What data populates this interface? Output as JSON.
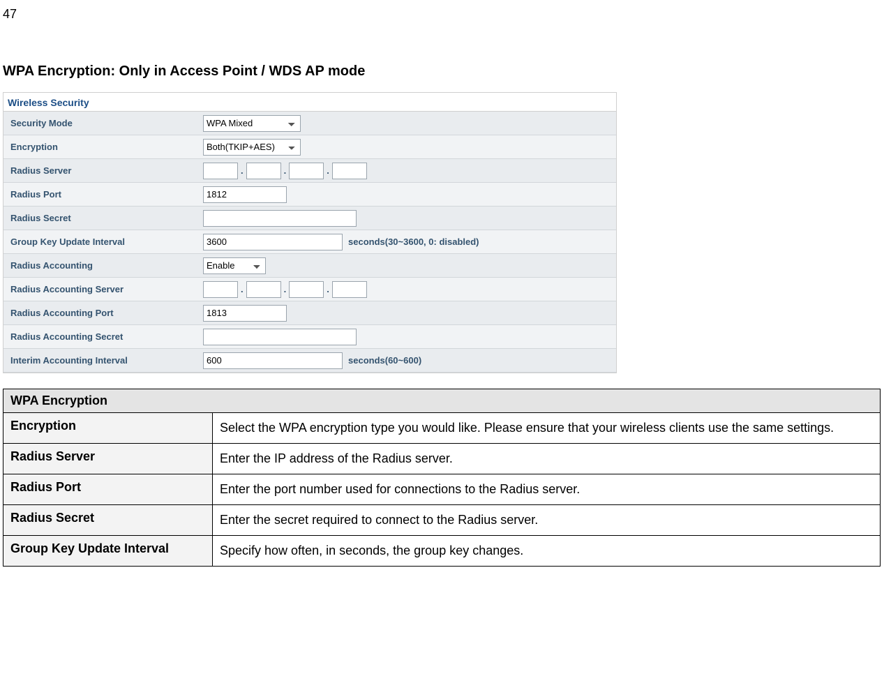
{
  "page_number": "47",
  "heading": "WPA Encryption: Only in Access Point / WDS AP mode",
  "screenshot": {
    "title": "Wireless Security",
    "rows": {
      "security_mode": {
        "label": "Security Mode",
        "value": "WPA Mixed"
      },
      "encryption": {
        "label": "Encryption",
        "value": "Both(TKIP+AES)"
      },
      "radius_server": {
        "label": "Radius Server",
        "octets": [
          "",
          "",
          "",
          ""
        ]
      },
      "radius_port": {
        "label": "Radius Port",
        "value": "1812"
      },
      "radius_secret": {
        "label": "Radius Secret",
        "value": ""
      },
      "group_key_interval": {
        "label": "Group Key Update Interval",
        "value": "3600",
        "suffix": "seconds(30~3600, 0: disabled)"
      },
      "radius_acct": {
        "label": "Radius Accounting",
        "value": "Enable"
      },
      "radius_acct_server": {
        "label": "Radius Accounting Server",
        "octets": [
          "",
          "",
          "",
          ""
        ]
      },
      "radius_acct_port": {
        "label": "Radius Accounting Port",
        "value": "1813"
      },
      "radius_acct_secret": {
        "label": "Radius Accounting Secret",
        "value": ""
      },
      "interim_interval": {
        "label": "Interim Accounting Interval",
        "value": "600",
        "suffix": "seconds(60~600)"
      }
    }
  },
  "definitions": {
    "header": "WPA Encryption",
    "rows": [
      {
        "key": "Encryption",
        "desc": "Select the WPA encryption type you would like.\nPlease ensure that your wireless clients use the same settings."
      },
      {
        "key": "Radius Server",
        "desc": "Enter the IP address of the Radius server."
      },
      {
        "key": "Radius Port",
        "desc": "Enter the port number used for connections to the Radius server."
      },
      {
        "key": "Radius Secret",
        "desc": "Enter the secret required to connect to the Radius server."
      },
      {
        "key": "Group Key Update Interval",
        "desc": "Specify how often, in seconds, the group key changes."
      }
    ]
  }
}
